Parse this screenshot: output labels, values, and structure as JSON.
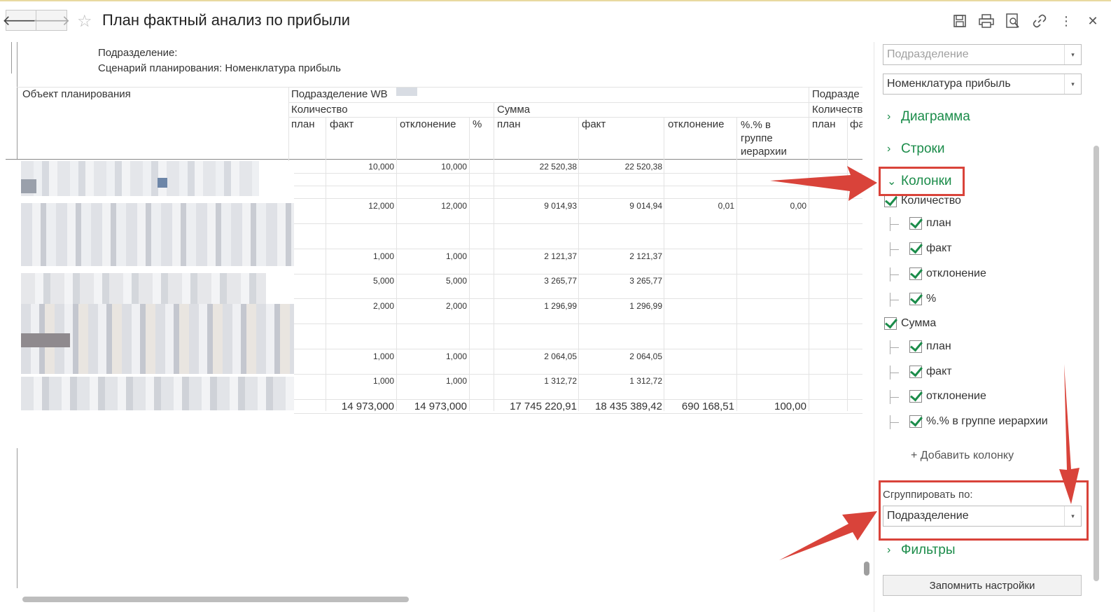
{
  "window": {
    "title": "План фактный анализ по прибыли"
  },
  "toolbar": {
    "icons": [
      "back-arrow-icon",
      "forward-arrow-icon",
      "star-icon",
      "save-icon",
      "print-icon",
      "preview-icon",
      "link-icon",
      "more-icon",
      "close-icon"
    ],
    "back": "🡐",
    "forward": "🡒",
    "star": "☆",
    "more": "⋮",
    "close": "✕"
  },
  "report": {
    "subdivision_label": "Подразделение:",
    "scenario_label": "Сценарий планирования: Номенклатура прибыль",
    "object_header": "Объект планирования",
    "group1_header": "Подразделение WB",
    "group2_header": "Подразде",
    "qty_header": "Количество",
    "qty_header2": "Количеств",
    "sum_header": "Сумма",
    "col_plan": "план",
    "col_fact": "факт",
    "col_dev": "отклонение",
    "col_pct": "%",
    "col_pct_group": "%.% в группе иерархии",
    "col_fact_cut": "фа",
    "rows": [
      {
        "qty_fact": "10,000",
        "qty_dev": "10,000",
        "sum_plan": "22 520,38",
        "sum_fact": "22 520,38",
        "sum_dev": "",
        "sum_pct": ""
      },
      {
        "qty_fact": "12,000",
        "qty_dev": "12,000",
        "sum_plan": "9 014,93",
        "sum_fact": "9 014,94",
        "sum_dev": "0,01",
        "sum_pct": "0,00"
      },
      {
        "qty_fact": "1,000",
        "qty_dev": "1,000",
        "sum_plan": "2 121,37",
        "sum_fact": "2 121,37",
        "sum_dev": "",
        "sum_pct": ""
      },
      {
        "qty_fact": "5,000",
        "qty_dev": "5,000",
        "sum_plan": "3 265,77",
        "sum_fact": "3 265,77",
        "sum_dev": "",
        "sum_pct": ""
      },
      {
        "qty_fact": "2,000",
        "qty_dev": "2,000",
        "sum_plan": "1 296,99",
        "sum_fact": "1 296,99",
        "sum_dev": "",
        "sum_pct": ""
      },
      {
        "qty_fact": "1,000",
        "qty_dev": "1,000",
        "sum_plan": "2 064,05",
        "sum_fact": "2 064,05",
        "sum_dev": "",
        "sum_pct": ""
      },
      {
        "qty_fact": "1,000",
        "qty_dev": "1,000",
        "sum_plan": "1 312,72",
        "sum_fact": "1 312,72",
        "sum_dev": "",
        "sum_pct": ""
      }
    ],
    "totals": {
      "qty_fact": "14 973,000",
      "qty_dev": "14 973,000",
      "sum_plan": "17 745 220,91",
      "sum_fact": "18 435 389,42",
      "sum_dev": "690 168,51",
      "sum_pct": "100,00"
    }
  },
  "panel": {
    "subdivision_placeholder": "Подразделение",
    "scenario_value": "Номенклатура прибыль",
    "section_chart": "Диаграмма",
    "section_rows": "Строки",
    "section_columns": "Колонки",
    "section_filters": "Фильтры",
    "qty_group": "Количество",
    "sum_group": "Сумма",
    "opt_plan": "план",
    "opt_fact": "факт",
    "opt_dev": "отклонение",
    "opt_pct": "%",
    "opt_pct_group": "%.% в группе иерархии",
    "add_column": "+ Добавить колонку",
    "group_by_label": "Сгруппировать по:",
    "group_by_value": "Подразделение",
    "save_settings": "Запомнить настройки",
    "chevron_right": "›",
    "chevron_down": "⌄",
    "dropdown_arrow": "▾"
  },
  "colors": {
    "accent_green": "#1b8c4a",
    "annotation_red": "#d9433a"
  }
}
